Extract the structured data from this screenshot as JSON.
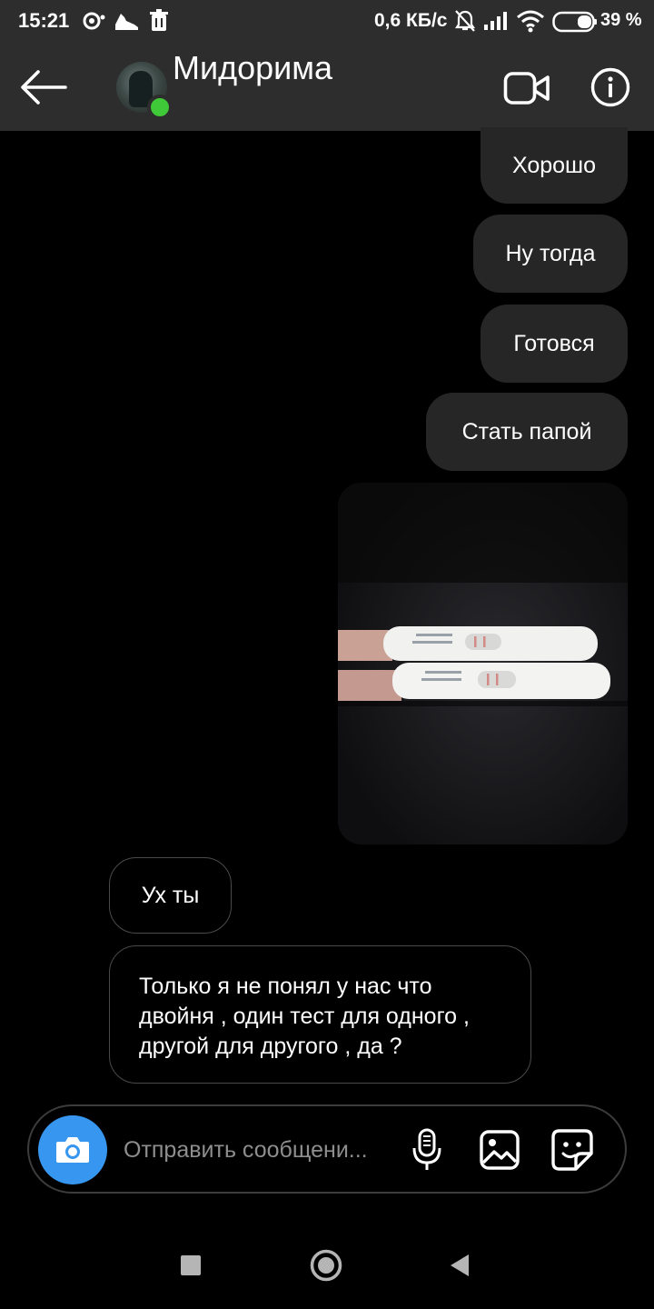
{
  "status_bar": {
    "time": "15:21",
    "net_speed": "0,6 КБ/с",
    "battery": "39 %",
    "icons": [
      "notification-icon",
      "shoe-icon",
      "trash-icon",
      "mute-icon",
      "signal-icon",
      "wifi-icon",
      "battery-icon"
    ]
  },
  "header": {
    "contact_name": "Мидорима",
    "online": true,
    "online_color": "#3fc837",
    "icons": [
      "back-arrow-icon",
      "video-call-icon",
      "info-icon"
    ]
  },
  "messages": [
    {
      "direction": "outgoing",
      "text": "Хорошо"
    },
    {
      "direction": "outgoing",
      "text": "Ну тогда"
    },
    {
      "direction": "outgoing",
      "text": "Готовся"
    },
    {
      "direction": "outgoing",
      "text": "Стать папой"
    },
    {
      "direction": "outgoing",
      "type": "photo"
    },
    {
      "direction": "incoming",
      "text": "Ух ты"
    },
    {
      "direction": "incoming",
      "text": "Только я не понял у нас что\nдвойня , один тест для одного ,\nдругой для другого , да ?"
    }
  ],
  "composer": {
    "placeholder": "Отправить сообщени...",
    "value": "",
    "camera_color": "#3797f0",
    "icons": [
      "camera-icon",
      "microphone-icon",
      "gallery-icon",
      "sticker-icon"
    ]
  },
  "nav_bar": {
    "icons": [
      "recents-square-icon",
      "home-circle-icon",
      "back-triangle-icon"
    ]
  }
}
